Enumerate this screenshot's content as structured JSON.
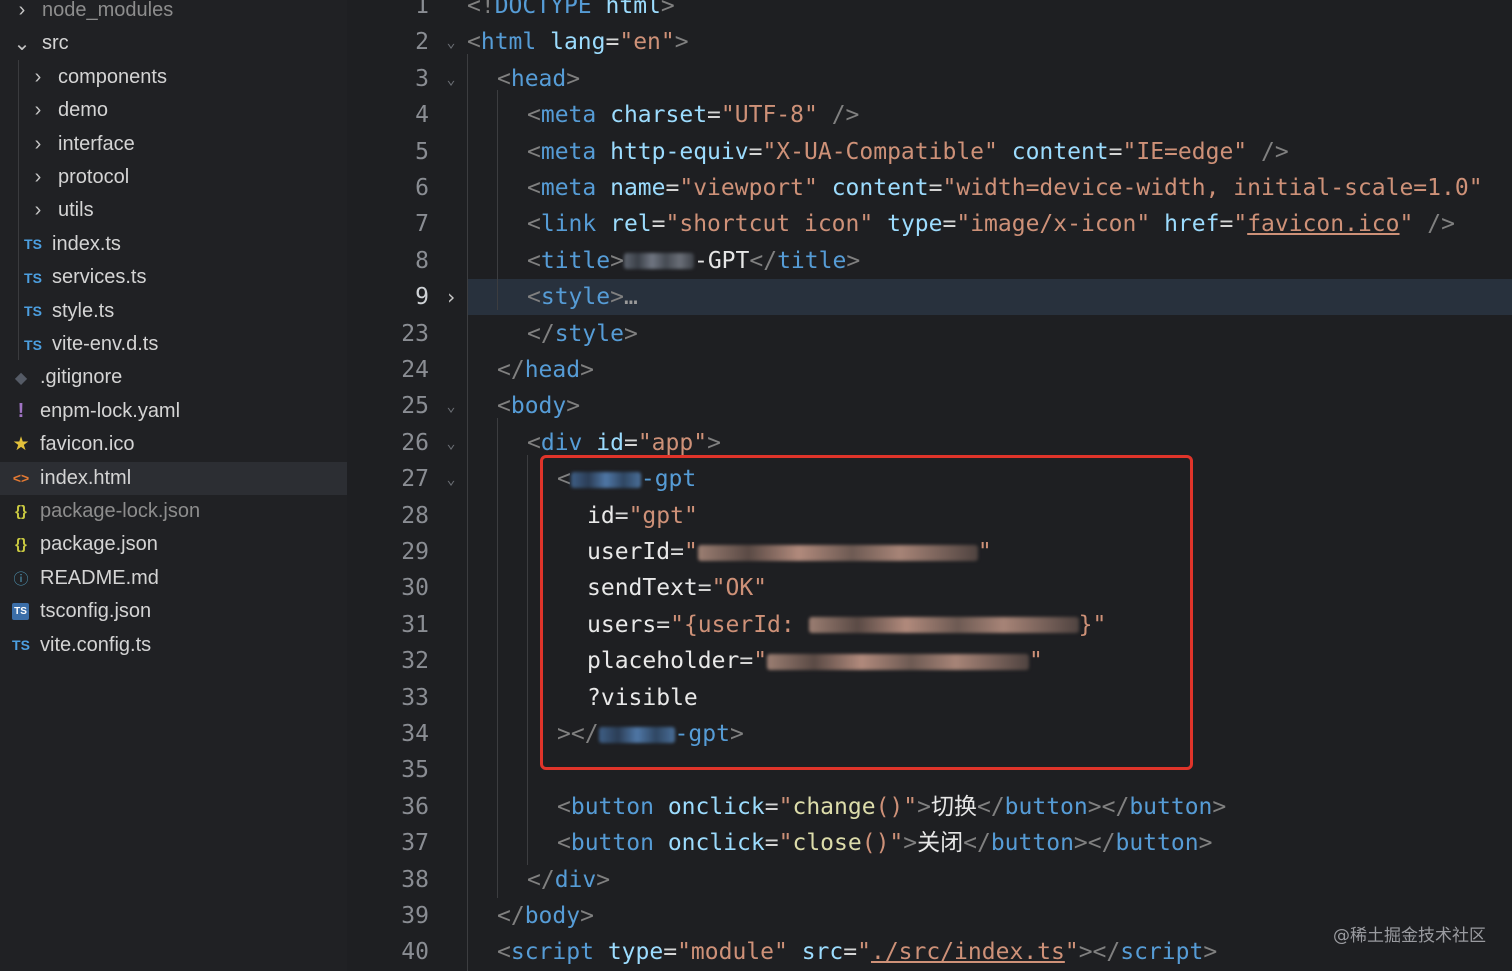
{
  "explorer": {
    "items": [
      {
        "label": "node_modules",
        "icon": "chevron-right-icon",
        "kind": "folder",
        "depth": 0,
        "dim": true
      },
      {
        "label": "src",
        "icon": "chevron-down-icon",
        "kind": "folder",
        "depth": 0,
        "dim": false
      },
      {
        "label": "components",
        "icon": "chevron-right-icon",
        "kind": "folder",
        "depth": 1,
        "dim": false
      },
      {
        "label": "demo",
        "icon": "chevron-right-icon",
        "kind": "folder",
        "depth": 1,
        "dim": false
      },
      {
        "label": "interface",
        "icon": "chevron-right-icon",
        "kind": "folder",
        "depth": 1,
        "dim": false
      },
      {
        "label": "protocol",
        "icon": "chevron-right-icon",
        "kind": "folder",
        "depth": 1,
        "dim": false
      },
      {
        "label": "utils",
        "icon": "chevron-right-icon",
        "kind": "folder",
        "depth": 1,
        "dim": false
      },
      {
        "label": "index.ts",
        "icon": "typescript-file-icon",
        "badge": "TS",
        "kind": "ts",
        "depth": 1,
        "dim": false
      },
      {
        "label": "services.ts",
        "icon": "typescript-file-icon",
        "badge": "TS",
        "kind": "ts",
        "depth": 1,
        "dim": false
      },
      {
        "label": "style.ts",
        "icon": "typescript-file-icon",
        "badge": "TS",
        "kind": "ts",
        "depth": 1,
        "dim": false
      },
      {
        "label": "vite-env.d.ts",
        "icon": "typescript-file-icon",
        "badge": "TS",
        "kind": "ts",
        "depth": 1,
        "dim": false
      },
      {
        "label": ".gitignore",
        "icon": "git-icon",
        "badge": "◆",
        "kind": "git",
        "depth": 0,
        "dim": false
      },
      {
        "label": "enpm-lock.yaml",
        "icon": "yaml-file-icon",
        "badge": "!",
        "kind": "yaml",
        "depth": 0,
        "dim": false
      },
      {
        "label": "favicon.ico",
        "icon": "star-icon",
        "badge": "★",
        "kind": "star",
        "depth": 0,
        "dim": false
      },
      {
        "label": "index.html",
        "icon": "html-file-icon",
        "badge": "<>",
        "kind": "html",
        "depth": 0,
        "dim": false,
        "selected": true
      },
      {
        "label": "package-lock.json",
        "icon": "json-file-icon",
        "badge": "{}",
        "kind": "json",
        "depth": 0,
        "dim": true
      },
      {
        "label": "package.json",
        "icon": "json-file-icon",
        "badge": "{}",
        "kind": "json",
        "depth": 0,
        "dim": false
      },
      {
        "label": "README.md",
        "icon": "info-icon",
        "badge": "ⓘ",
        "kind": "info",
        "depth": 0,
        "dim": false
      },
      {
        "label": "tsconfig.json",
        "icon": "tsconfig-file-icon",
        "badge": "TS",
        "kind": "tsbox",
        "depth": 0,
        "dim": false
      },
      {
        "label": "vite.config.ts",
        "icon": "typescript-file-icon",
        "badge": "TS",
        "kind": "ts",
        "depth": 0,
        "dim": false
      }
    ]
  },
  "editor": {
    "active_line": "9",
    "lines": [
      {
        "n": "1",
        "fold": "",
        "indent": 0,
        "tokens": [
          [
            "b",
            "<!"
          ],
          [
            "tag",
            "DOCTYPE"
          ],
          [
            "t",
            " "
          ],
          [
            "attr",
            "html"
          ],
          [
            "b",
            ">"
          ]
        ]
      },
      {
        "n": "2",
        "fold": "open",
        "indent": 0,
        "tokens": [
          [
            "b",
            "<"
          ],
          [
            "tag",
            "html"
          ],
          [
            "t",
            " "
          ],
          [
            "attr",
            "lang"
          ],
          [
            "t",
            "="
          ],
          [
            "str",
            "\"en\""
          ],
          [
            "b",
            ">"
          ]
        ]
      },
      {
        "n": "3",
        "fold": "open",
        "indent": 1,
        "tokens": [
          [
            "b",
            "<"
          ],
          [
            "tag",
            "head"
          ],
          [
            "b",
            ">"
          ]
        ]
      },
      {
        "n": "4",
        "fold": "",
        "indent": 2,
        "tokens": [
          [
            "b",
            "<"
          ],
          [
            "tag",
            "meta"
          ],
          [
            "t",
            " "
          ],
          [
            "attr",
            "charset"
          ],
          [
            "t",
            "="
          ],
          [
            "str",
            "\"UTF-8\""
          ],
          [
            "t",
            " "
          ],
          [
            "b",
            "/>"
          ]
        ]
      },
      {
        "n": "5",
        "fold": "",
        "indent": 2,
        "tokens": [
          [
            "b",
            "<"
          ],
          [
            "tag",
            "meta"
          ],
          [
            "t",
            " "
          ],
          [
            "attr",
            "http-equiv"
          ],
          [
            "t",
            "="
          ],
          [
            "str",
            "\"X-UA-Compatible\""
          ],
          [
            "t",
            " "
          ],
          [
            "attr",
            "content"
          ],
          [
            "t",
            "="
          ],
          [
            "str",
            "\"IE=edge\""
          ],
          [
            "t",
            " "
          ],
          [
            "b",
            "/>"
          ]
        ]
      },
      {
        "n": "6",
        "fold": "",
        "indent": 2,
        "tokens": [
          [
            "b",
            "<"
          ],
          [
            "tag",
            "meta"
          ],
          [
            "t",
            " "
          ],
          [
            "attr",
            "name"
          ],
          [
            "t",
            "="
          ],
          [
            "str",
            "\"viewport\""
          ],
          [
            "t",
            " "
          ],
          [
            "attr",
            "content"
          ],
          [
            "t",
            "="
          ],
          [
            "str",
            "\"width=device-width, initial-scale=1.0\""
          ]
        ]
      },
      {
        "n": "7",
        "fold": "",
        "indent": 2,
        "tokens": [
          [
            "b",
            "<"
          ],
          [
            "tag",
            "link"
          ],
          [
            "t",
            " "
          ],
          [
            "attr",
            "rel"
          ],
          [
            "t",
            "="
          ],
          [
            "str",
            "\"shortcut icon\""
          ],
          [
            "t",
            " "
          ],
          [
            "attr",
            "type"
          ],
          [
            "t",
            "="
          ],
          [
            "str",
            "\"image/x-icon\""
          ],
          [
            "t",
            " "
          ],
          [
            "attr",
            "href"
          ],
          [
            "t",
            "="
          ],
          [
            "str",
            "\""
          ],
          [
            "link",
            "favicon.ico"
          ],
          [
            "str",
            "\""
          ],
          [
            "t",
            " "
          ],
          [
            "b",
            "/>"
          ]
        ]
      },
      {
        "n": "8",
        "fold": "",
        "indent": 2,
        "tokens": [
          [
            "b",
            "<"
          ],
          [
            "tag",
            "title"
          ],
          [
            "b",
            ">"
          ],
          [
            "blur",
            "70"
          ],
          [
            "txt",
            "-GPT"
          ],
          [
            "b",
            "</"
          ],
          [
            "tag",
            "title"
          ],
          [
            "b",
            ">"
          ]
        ]
      },
      {
        "n": "9",
        "fold": "closed",
        "indent": 2,
        "tokens": [
          [
            "b",
            "<"
          ],
          [
            "tag",
            "style"
          ],
          [
            "b",
            ">"
          ],
          [
            "ell",
            "…"
          ]
        ]
      },
      {
        "n": "23",
        "fold": "",
        "indent": 2,
        "tokens": [
          [
            "b",
            "</"
          ],
          [
            "tag",
            "style"
          ],
          [
            "b",
            ">"
          ]
        ]
      },
      {
        "n": "24",
        "fold": "",
        "indent": 1,
        "tokens": [
          [
            "b",
            "</"
          ],
          [
            "tag",
            "head"
          ],
          [
            "b",
            ">"
          ]
        ]
      },
      {
        "n": "25",
        "fold": "open",
        "indent": 1,
        "tokens": [
          [
            "b",
            "<"
          ],
          [
            "tag",
            "body"
          ],
          [
            "b",
            ">"
          ]
        ]
      },
      {
        "n": "26",
        "fold": "open",
        "indent": 2,
        "tokens": [
          [
            "b",
            "<"
          ],
          [
            "tag",
            "div"
          ],
          [
            "t",
            " "
          ],
          [
            "attr",
            "id"
          ],
          [
            "t",
            "="
          ],
          [
            "str",
            "\"app\""
          ],
          [
            "b",
            ">"
          ]
        ]
      },
      {
        "n": "27",
        "fold": "open",
        "indent": 3,
        "tokens": [
          [
            "b",
            "<"
          ],
          [
            "blurtag",
            "70"
          ],
          [
            "tag",
            "-gpt"
          ]
        ]
      },
      {
        "n": "28",
        "fold": "",
        "indent": 4,
        "tokens": [
          [
            "attrw",
            "id"
          ],
          [
            "t",
            "="
          ],
          [
            "str",
            "\"gpt\""
          ]
        ]
      },
      {
        "n": "29",
        "fold": "",
        "indent": 4,
        "tokens": [
          [
            "attrw",
            "userId"
          ],
          [
            "t",
            "="
          ],
          [
            "str",
            "\""
          ],
          [
            "blurstr",
            "280"
          ],
          [
            "str",
            "\""
          ]
        ]
      },
      {
        "n": "30",
        "fold": "",
        "indent": 4,
        "tokens": [
          [
            "attrw",
            "sendText"
          ],
          [
            "t",
            "="
          ],
          [
            "str",
            "\"OK\""
          ]
        ]
      },
      {
        "n": "31",
        "fold": "",
        "indent": 4,
        "tokens": [
          [
            "attrw",
            "users"
          ],
          [
            "t",
            "="
          ],
          [
            "str",
            "\"{userId: "
          ],
          [
            "blurstr",
            "270"
          ],
          [
            "str",
            "}\""
          ]
        ]
      },
      {
        "n": "32",
        "fold": "",
        "indent": 4,
        "tokens": [
          [
            "attrw",
            "placeholder"
          ],
          [
            "t",
            "="
          ],
          [
            "str",
            "\""
          ],
          [
            "blurstr",
            "262"
          ],
          [
            "str",
            "\""
          ]
        ]
      },
      {
        "n": "33",
        "fold": "",
        "indent": 4,
        "tokens": [
          [
            "attrw",
            "?visible"
          ]
        ]
      },
      {
        "n": "34",
        "fold": "",
        "indent": 3,
        "tokens": [
          [
            "b",
            "></"
          ],
          [
            "blurtag",
            "76"
          ],
          [
            "tag",
            "-gpt"
          ],
          [
            "b",
            ">"
          ]
        ]
      },
      {
        "n": "35",
        "fold": "",
        "indent": 3,
        "tokens": []
      },
      {
        "n": "36",
        "fold": "",
        "indent": 3,
        "tokens": [
          [
            "b",
            "<"
          ],
          [
            "tag",
            "button"
          ],
          [
            "t",
            " "
          ],
          [
            "attr",
            "onclick"
          ],
          [
            "t",
            "="
          ],
          [
            "str",
            "\""
          ],
          [
            "fn",
            "change"
          ],
          [
            "str",
            "()\""
          ],
          [
            "b",
            ">"
          ],
          [
            "txt",
            "切换"
          ],
          [
            "b",
            "</"
          ],
          [
            "tag",
            "button"
          ],
          [
            "b",
            "></"
          ],
          [
            "tag",
            "button"
          ],
          [
            "b",
            ">"
          ]
        ]
      },
      {
        "n": "37",
        "fold": "",
        "indent": 3,
        "tokens": [
          [
            "b",
            "<"
          ],
          [
            "tag",
            "button"
          ],
          [
            "t",
            " "
          ],
          [
            "attr",
            "onclick"
          ],
          [
            "t",
            "="
          ],
          [
            "str",
            "\""
          ],
          [
            "fn",
            "close"
          ],
          [
            "str",
            "()\""
          ],
          [
            "b",
            ">"
          ],
          [
            "txt",
            "关闭"
          ],
          [
            "b",
            "</"
          ],
          [
            "tag",
            "button"
          ],
          [
            "b",
            "></"
          ],
          [
            "tag",
            "button"
          ],
          [
            "b",
            ">"
          ]
        ]
      },
      {
        "n": "38",
        "fold": "",
        "indent": 2,
        "tokens": [
          [
            "b",
            "</"
          ],
          [
            "tag",
            "div"
          ],
          [
            "b",
            ">"
          ]
        ]
      },
      {
        "n": "39",
        "fold": "",
        "indent": 1,
        "tokens": [
          [
            "b",
            "</"
          ],
          [
            "tag",
            "body"
          ],
          [
            "b",
            ">"
          ]
        ]
      },
      {
        "n": "40",
        "fold": "",
        "indent": 1,
        "tokens": [
          [
            "b",
            "<"
          ],
          [
            "tag",
            "script"
          ],
          [
            "t",
            " "
          ],
          [
            "attr",
            "type"
          ],
          [
            "t",
            "="
          ],
          [
            "str",
            "\"module\""
          ],
          [
            "t",
            " "
          ],
          [
            "attr",
            "src"
          ],
          [
            "t",
            "="
          ],
          [
            "str",
            "\""
          ],
          [
            "link",
            "./src/index.ts"
          ],
          [
            "str",
            "\""
          ],
          [
            "b",
            "></"
          ],
          [
            "tag",
            "script"
          ],
          [
            "b",
            ">"
          ]
        ]
      }
    ]
  },
  "watermark": "@稀土掘金技术社区",
  "colors": {
    "tag": "#569cd6",
    "attr": "#9cdcfe",
    "string": "#ce9178",
    "highlight_box": "#e0342a"
  }
}
